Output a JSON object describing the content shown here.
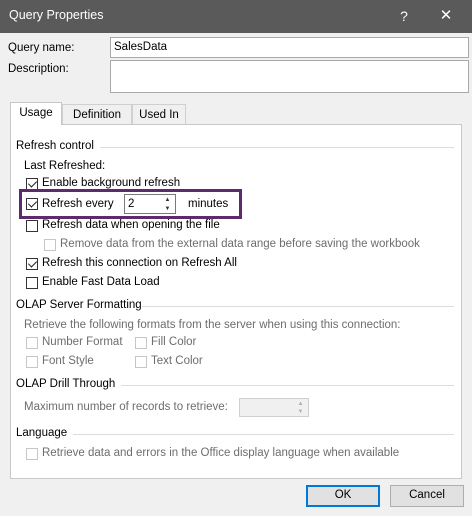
{
  "window": {
    "title": "Query Properties",
    "help_glyph": "?",
    "close_glyph": "✕"
  },
  "header": {
    "query_name_label": "Query name:",
    "query_name_value": "SalesData",
    "description_label": "Description:",
    "description_value": ""
  },
  "tabs": [
    {
      "label": "Usage",
      "active": true
    },
    {
      "label": "Definition",
      "active": false
    },
    {
      "label": "Used In",
      "active": false
    }
  ],
  "refresh_control": {
    "group_title": "Refresh control",
    "last_refreshed_label": "Last Refreshed:",
    "enable_background_refresh": {
      "label": "Enable background refresh",
      "checked": true
    },
    "refresh_every": {
      "label": "Refresh every",
      "checked": true,
      "value": "2",
      "unit": "minutes"
    },
    "refresh_on_open": {
      "label": "Refresh data when opening the file",
      "checked": false
    },
    "remove_data": {
      "label": "Remove data from the external data range before saving the workbook",
      "checked": false,
      "disabled": true
    },
    "refresh_all": {
      "label": "Refresh this connection on Refresh All",
      "checked": true
    },
    "fast_data_load": {
      "label": "Enable Fast Data Load",
      "checked": false
    }
  },
  "olap_formatting": {
    "group_title": "OLAP Server Formatting",
    "description": "Retrieve the following formats from the server when using this connection:",
    "number_format": "Number Format",
    "fill_color": "Fill Color",
    "font_style": "Font Style",
    "text_color": "Text Color"
  },
  "olap_drill": {
    "group_title": "OLAP Drill Through",
    "max_records_label": "Maximum number of records to retrieve:",
    "max_records_value": ""
  },
  "language": {
    "group_title": "Language",
    "retrieve_label": "Retrieve data and errors in the Office display language when available"
  },
  "buttons": {
    "ok": "OK",
    "cancel": "Cancel"
  },
  "colors": {
    "titlebar": "#5a5a5a",
    "highlight_border": "#5d2a6e",
    "default_button_border": "#0078d7"
  }
}
